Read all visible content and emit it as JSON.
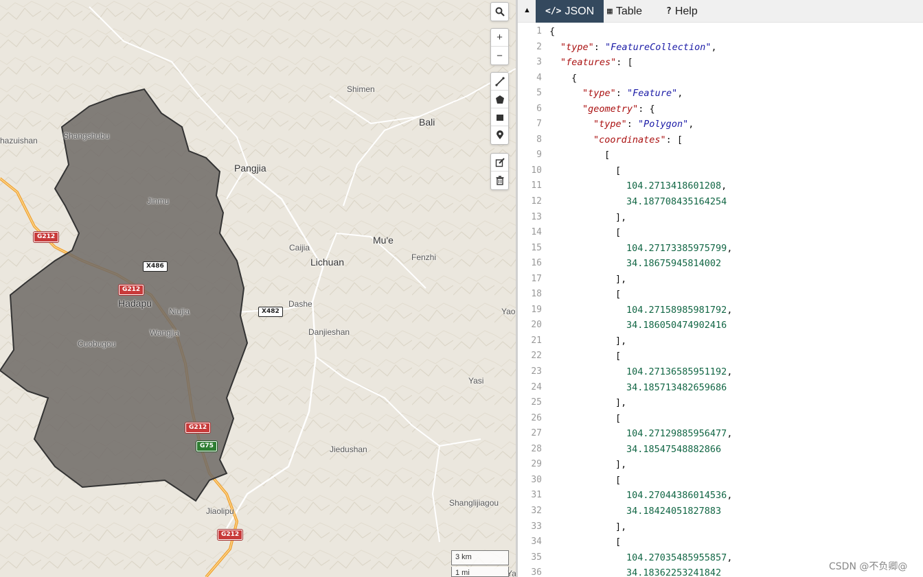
{
  "map": {
    "places": [
      {
        "id": "shimen",
        "label": "Shimen"
      },
      {
        "id": "bali",
        "label": "Bali"
      },
      {
        "id": "hazuishan",
        "label": "hazuishan"
      },
      {
        "id": "shangshubu",
        "label": "Shangshubu"
      },
      {
        "id": "pangjia",
        "label": "Pangjia"
      },
      {
        "id": "jinmu",
        "label": "Jinmu"
      },
      {
        "id": "caijia",
        "label": "Caijia"
      },
      {
        "id": "mue",
        "label": "Mu'e"
      },
      {
        "id": "lichuan",
        "label": "Lichuan"
      },
      {
        "id": "fenzhi",
        "label": "Fenzhi"
      },
      {
        "id": "hadapu",
        "label": "Hadapu"
      },
      {
        "id": "niujia",
        "label": "Niujia"
      },
      {
        "id": "dashe",
        "label": "Dashe"
      },
      {
        "id": "yaoz",
        "label": "Yaoz"
      },
      {
        "id": "wangjia",
        "label": "Wangjia"
      },
      {
        "id": "danjieshan",
        "label": "Danjieshan"
      },
      {
        "id": "cuobugou",
        "label": "Cuobugou"
      },
      {
        "id": "yasi",
        "label": "Yasi"
      },
      {
        "id": "jiedushan",
        "label": "Jiedushan"
      },
      {
        "id": "shanglijiagou",
        "label": "Shanglijiagou"
      },
      {
        "id": "jiaolipu",
        "label": "Jiaolipu"
      },
      {
        "id": "ya",
        "label": "Ya"
      }
    ],
    "shields": [
      {
        "id": "g212-a",
        "label": "G212",
        "kind": "red"
      },
      {
        "id": "x486",
        "label": "X486",
        "kind": "white"
      },
      {
        "id": "g212-b",
        "label": "G212",
        "kind": "red"
      },
      {
        "id": "x482",
        "label": "X482",
        "kind": "white"
      },
      {
        "id": "g212-c",
        "label": "G212",
        "kind": "red"
      },
      {
        "id": "g75",
        "label": "G75",
        "kind": "green"
      },
      {
        "id": "g212-d",
        "label": "G212",
        "kind": "red"
      }
    ],
    "controls": {
      "search": "search-icon",
      "zoom_in": "+",
      "zoom_out": "−",
      "draw_tools": [
        "draw-line-icon",
        "draw-polygon-icon",
        "draw-rectangle-icon",
        "draw-marker-icon"
      ],
      "edit_tools": [
        "edit-icon",
        "delete-icon"
      ]
    },
    "scale": {
      "metric": "3 km",
      "imperial": "1 mi"
    },
    "colors": {
      "polygon_fill": "#6e6a66",
      "polygon_stroke": "#333333",
      "highway": "#f0a030"
    }
  },
  "editor": {
    "tabs": [
      {
        "id": "json",
        "icon": "</>",
        "label": "JSON",
        "active": true
      },
      {
        "id": "table",
        "icon": "▦",
        "label": "Table",
        "active": false
      },
      {
        "id": "help",
        "icon": "?",
        "label": "Help",
        "active": false
      }
    ],
    "lines": [
      {
        "n": "1",
        "indent": 0,
        "parts": [
          [
            "p",
            "{"
          ]
        ]
      },
      {
        "n": "2",
        "indent": 1,
        "parts": [
          [
            "k",
            "\"type\""
          ],
          [
            "p",
            ": "
          ],
          [
            "s",
            "\"FeatureCollection\""
          ],
          [
            "p",
            ","
          ]
        ]
      },
      {
        "n": "3",
        "indent": 1,
        "parts": [
          [
            "k",
            "\"features\""
          ],
          [
            "p",
            ": ["
          ]
        ]
      },
      {
        "n": "4",
        "indent": 2,
        "parts": [
          [
            "p",
            "{"
          ]
        ]
      },
      {
        "n": "5",
        "indent": 3,
        "parts": [
          [
            "k",
            "\"type\""
          ],
          [
            "p",
            ": "
          ],
          [
            "s",
            "\"Feature\""
          ],
          [
            "p",
            ","
          ]
        ]
      },
      {
        "n": "6",
        "indent": 3,
        "parts": [
          [
            "k",
            "\"geometry\""
          ],
          [
            "p",
            ": {"
          ]
        ]
      },
      {
        "n": "7",
        "indent": 4,
        "parts": [
          [
            "k",
            "\"type\""
          ],
          [
            "p",
            ": "
          ],
          [
            "s",
            "\"Polygon\""
          ],
          [
            "p",
            ","
          ]
        ]
      },
      {
        "n": "8",
        "indent": 4,
        "parts": [
          [
            "k",
            "\"coordinates\""
          ],
          [
            "p",
            ": ["
          ]
        ]
      },
      {
        "n": "9",
        "indent": 5,
        "parts": [
          [
            "p",
            "["
          ]
        ]
      },
      {
        "n": "10",
        "indent": 6,
        "parts": [
          [
            "p",
            "["
          ]
        ]
      },
      {
        "n": "11",
        "indent": 7,
        "parts": [
          [
            "n",
            "104.2713418601208"
          ],
          [
            "p",
            ","
          ]
        ]
      },
      {
        "n": "12",
        "indent": 7,
        "parts": [
          [
            "n",
            "34.187708435164254"
          ]
        ]
      },
      {
        "n": "13",
        "indent": 6,
        "parts": [
          [
            "p",
            "],"
          ]
        ]
      },
      {
        "n": "14",
        "indent": 6,
        "parts": [
          [
            "p",
            "["
          ]
        ]
      },
      {
        "n": "15",
        "indent": 7,
        "parts": [
          [
            "n",
            "104.27173385975799"
          ],
          [
            "p",
            ","
          ]
        ]
      },
      {
        "n": "16",
        "indent": 7,
        "parts": [
          [
            "n",
            "34.18675945814002"
          ]
        ]
      },
      {
        "n": "17",
        "indent": 6,
        "parts": [
          [
            "p",
            "],"
          ]
        ]
      },
      {
        "n": "18",
        "indent": 6,
        "parts": [
          [
            "p",
            "["
          ]
        ]
      },
      {
        "n": "19",
        "indent": 7,
        "parts": [
          [
            "n",
            "104.27158985981792"
          ],
          [
            "p",
            ","
          ]
        ]
      },
      {
        "n": "20",
        "indent": 7,
        "parts": [
          [
            "n",
            "34.186050474902416"
          ]
        ]
      },
      {
        "n": "21",
        "indent": 6,
        "parts": [
          [
            "p",
            "],"
          ]
        ]
      },
      {
        "n": "22",
        "indent": 6,
        "parts": [
          [
            "p",
            "["
          ]
        ]
      },
      {
        "n": "23",
        "indent": 7,
        "parts": [
          [
            "n",
            "104.27136585951192"
          ],
          [
            "p",
            ","
          ]
        ]
      },
      {
        "n": "24",
        "indent": 7,
        "parts": [
          [
            "n",
            "34.185713482659686"
          ]
        ]
      },
      {
        "n": "25",
        "indent": 6,
        "parts": [
          [
            "p",
            "],"
          ]
        ]
      },
      {
        "n": "26",
        "indent": 6,
        "parts": [
          [
            "p",
            "["
          ]
        ]
      },
      {
        "n": "27",
        "indent": 7,
        "parts": [
          [
            "n",
            "104.27129885956477"
          ],
          [
            "p",
            ","
          ]
        ]
      },
      {
        "n": "28",
        "indent": 7,
        "parts": [
          [
            "n",
            "34.18547548882866"
          ]
        ]
      },
      {
        "n": "29",
        "indent": 6,
        "parts": [
          [
            "p",
            "],"
          ]
        ]
      },
      {
        "n": "30",
        "indent": 6,
        "parts": [
          [
            "p",
            "["
          ]
        ]
      },
      {
        "n": "31",
        "indent": 7,
        "parts": [
          [
            "n",
            "104.27044386014536"
          ],
          [
            "p",
            ","
          ]
        ]
      },
      {
        "n": "32",
        "indent": 7,
        "parts": [
          [
            "n",
            "34.18424051827883"
          ]
        ]
      },
      {
        "n": "33",
        "indent": 6,
        "parts": [
          [
            "p",
            "],"
          ]
        ]
      },
      {
        "n": "34",
        "indent": 6,
        "parts": [
          [
            "p",
            "["
          ]
        ]
      },
      {
        "n": "35",
        "indent": 7,
        "parts": [
          [
            "n",
            "104.27035485955857"
          ],
          [
            "p",
            ","
          ]
        ]
      },
      {
        "n": "36",
        "indent": 7,
        "parts": [
          [
            "n",
            "34.18362253241842"
          ]
        ]
      }
    ]
  },
  "watermark": "CSDN @不负卿@"
}
